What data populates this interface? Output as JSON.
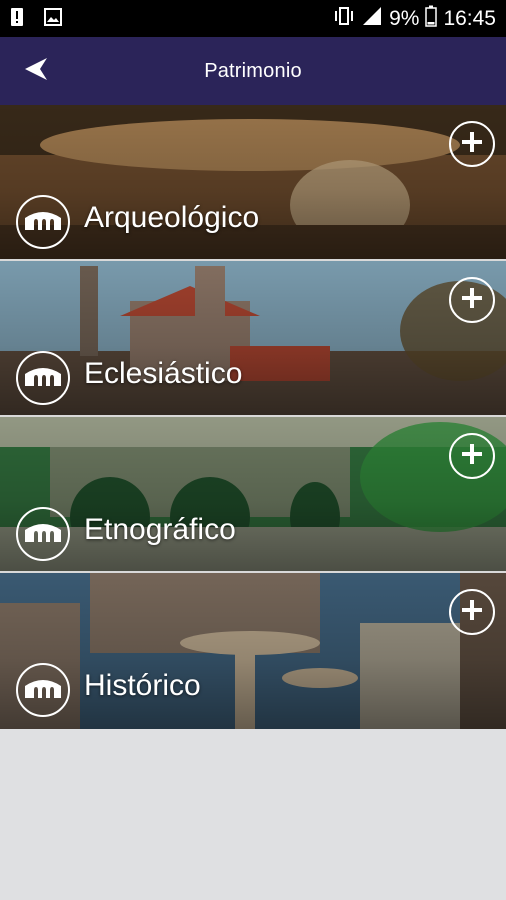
{
  "status_bar": {
    "battery_percent": "9%",
    "time": "16:45",
    "icons": [
      "alert-icon",
      "image-icon",
      "vibrate-icon",
      "signal-icon",
      "battery-icon"
    ]
  },
  "toolbar": {
    "title": "Patrimonio",
    "back_icon": "back-arrow-icon"
  },
  "categories": [
    {
      "label": "Arqueológico",
      "icon": "bridge-icon",
      "action_icon": "plus-icon",
      "palette": [
        "#6b4a2c",
        "#a07a4e",
        "#3a2b1a",
        "#c9b08a"
      ]
    },
    {
      "label": "Eclesiástico",
      "icon": "bridge-icon",
      "action_icon": "plus-icon",
      "palette": [
        "#7fa2b5",
        "#8a7465",
        "#a8432f",
        "#5b4a3c"
      ]
    },
    {
      "label": "Etnográfico",
      "icon": "bridge-icon",
      "action_icon": "plus-icon",
      "palette": [
        "#2f6b3a",
        "#6f7c63",
        "#9aa08a",
        "#1e4a28"
      ]
    },
    {
      "label": "Histórico",
      "icon": "bridge-icon",
      "action_icon": "plus-icon",
      "palette": [
        "#3d5e78",
        "#7a6a5c",
        "#b9a78c",
        "#5a4b3e"
      ]
    }
  ],
  "colors": {
    "status_bar": "#000000",
    "toolbar": "#2b2459",
    "background": "#dfe0e2"
  }
}
